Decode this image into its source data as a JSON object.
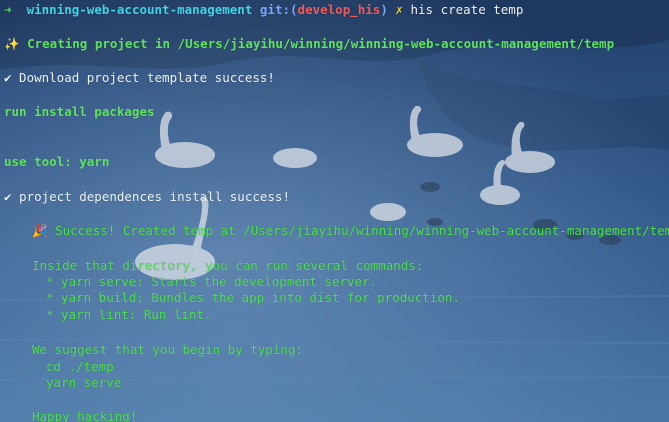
{
  "prompt": {
    "arrow": "➜",
    "directory": "winning-web-account-management",
    "git_prefix": "git:(",
    "branch": "develop_his",
    "git_suffix": ")",
    "dirty_marker": "✗",
    "command": "his create temp"
  },
  "lines": {
    "creating": "✨ Creating project in /Users/jiayihu/winning/winning-web-account-management/temp",
    "download": "✔ Download project template success!",
    "install": "run install packages",
    "tool": "use tool: yarn",
    "deps": "✔ project dependences install success!",
    "success": "🎉 Success! Created temp at /Users/jiayihu/winning/winning-web-account-management/temp.",
    "inside": "Inside that directory, you can run several commands:",
    "cmd_serve": "* yarn serve: Starts the development server.",
    "cmd_build": "* yarn build: Bundles the app into dist for production.",
    "cmd_lint": "* yarn lint: Run lint.",
    "suggest": "We suggest that you begin by typing:",
    "cd": "cd ./temp",
    "serve": "yarn serve",
    "happy": "Happy hacking!"
  },
  "colors": {
    "background": "#274a78",
    "green": "#4be24b",
    "cyan": "#41d3e6",
    "branch_red": "#f05a5a",
    "git_blue": "#7aa8ff",
    "text": "#eef2f6"
  },
  "background_image": "lake-with-swans"
}
